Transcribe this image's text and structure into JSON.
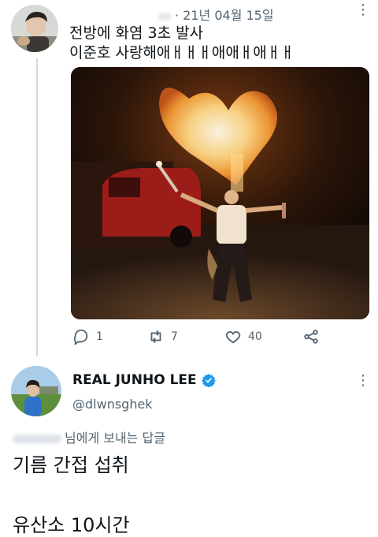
{
  "tweet": {
    "date": "21년 04월 15일",
    "text_line1": "전방에 화염 3초 발사",
    "text_line2": "이준호 사랑해애ㅐㅐㅐ애애ㅐ애ㅐㅐ",
    "more_icon": "⋮",
    "actions": {
      "reply_count": "1",
      "retweet_count": "7",
      "like_count": "40"
    }
  },
  "reply": {
    "display_name": "REAL JUNHO LEE",
    "handle": "@dlwnsghek",
    "more_icon": "⋮",
    "reply_to_label": "님에게 보내는 답글",
    "text_line1": "기름 간접 섭취",
    "text_line2": "유산소 10시간"
  },
  "colors": {
    "verified": "#1d9bf0",
    "secondary_text": "#536471",
    "thread_line": "#cfd9de"
  }
}
